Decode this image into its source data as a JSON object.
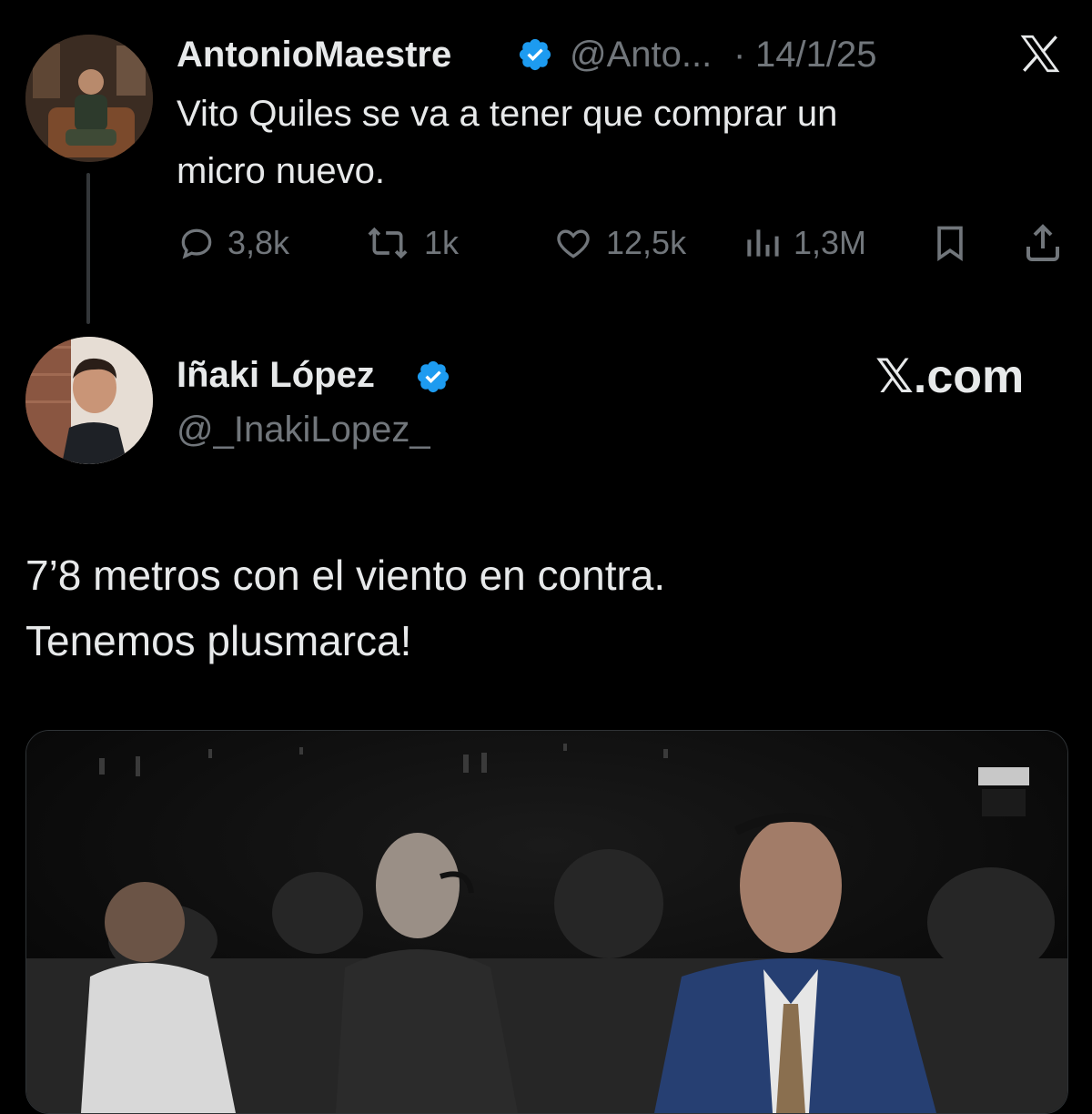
{
  "reply_tweet": {
    "display_name": "AntonioMaestre",
    "handle": "@Anto...",
    "date_sep": "·",
    "date": "14/1/25",
    "text_line1": "Vito Quiles se va a tener que comprar un",
    "text_line2": "micro nuevo.",
    "actions": {
      "replies": "3,8k",
      "reposts": "1k",
      "likes": "12,5k",
      "views": "1,3M"
    }
  },
  "quoted_tweet": {
    "display_name": "Iñaki López",
    "handle": "@_InakiLopez_",
    "watermark": "𝕏.com",
    "text_line1": "7’8 metros con el viento en contra.",
    "text_line2": "Tenemos plusmarca!"
  },
  "colors": {
    "background": "#000000",
    "text": "#e7e9ea",
    "muted": "#71767b",
    "verified": "#1d9bf0"
  },
  "icons": [
    "verified-badge-icon",
    "x-logo-icon",
    "reply-icon",
    "repost-icon",
    "like-icon",
    "views-icon",
    "bookmark-icon",
    "share-icon"
  ]
}
